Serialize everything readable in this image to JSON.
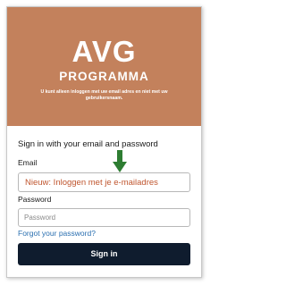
{
  "banner": {
    "logo_top": "AVG",
    "logo_bottom": "PROGRAMMA",
    "tagline": "U kunt alleen inloggen met uw email adres en niet met uw gebruikersnaam."
  },
  "form": {
    "heading": "Sign in with your email and password",
    "email_label": "Email",
    "email_value": "Nieuw: Inloggen met je e-mailadres",
    "password_label": "Password",
    "password_placeholder": "Password",
    "forgot_link": "Forgot your password?",
    "signin_button": "Sign in"
  },
  "colors": {
    "banner": "#c3815c",
    "button": "#0f1c2e",
    "arrow": "#2e7d32",
    "email_text": "#c0562f",
    "link": "#2a6fb0"
  },
  "icons": {
    "arrow": "arrow-down-icon"
  }
}
